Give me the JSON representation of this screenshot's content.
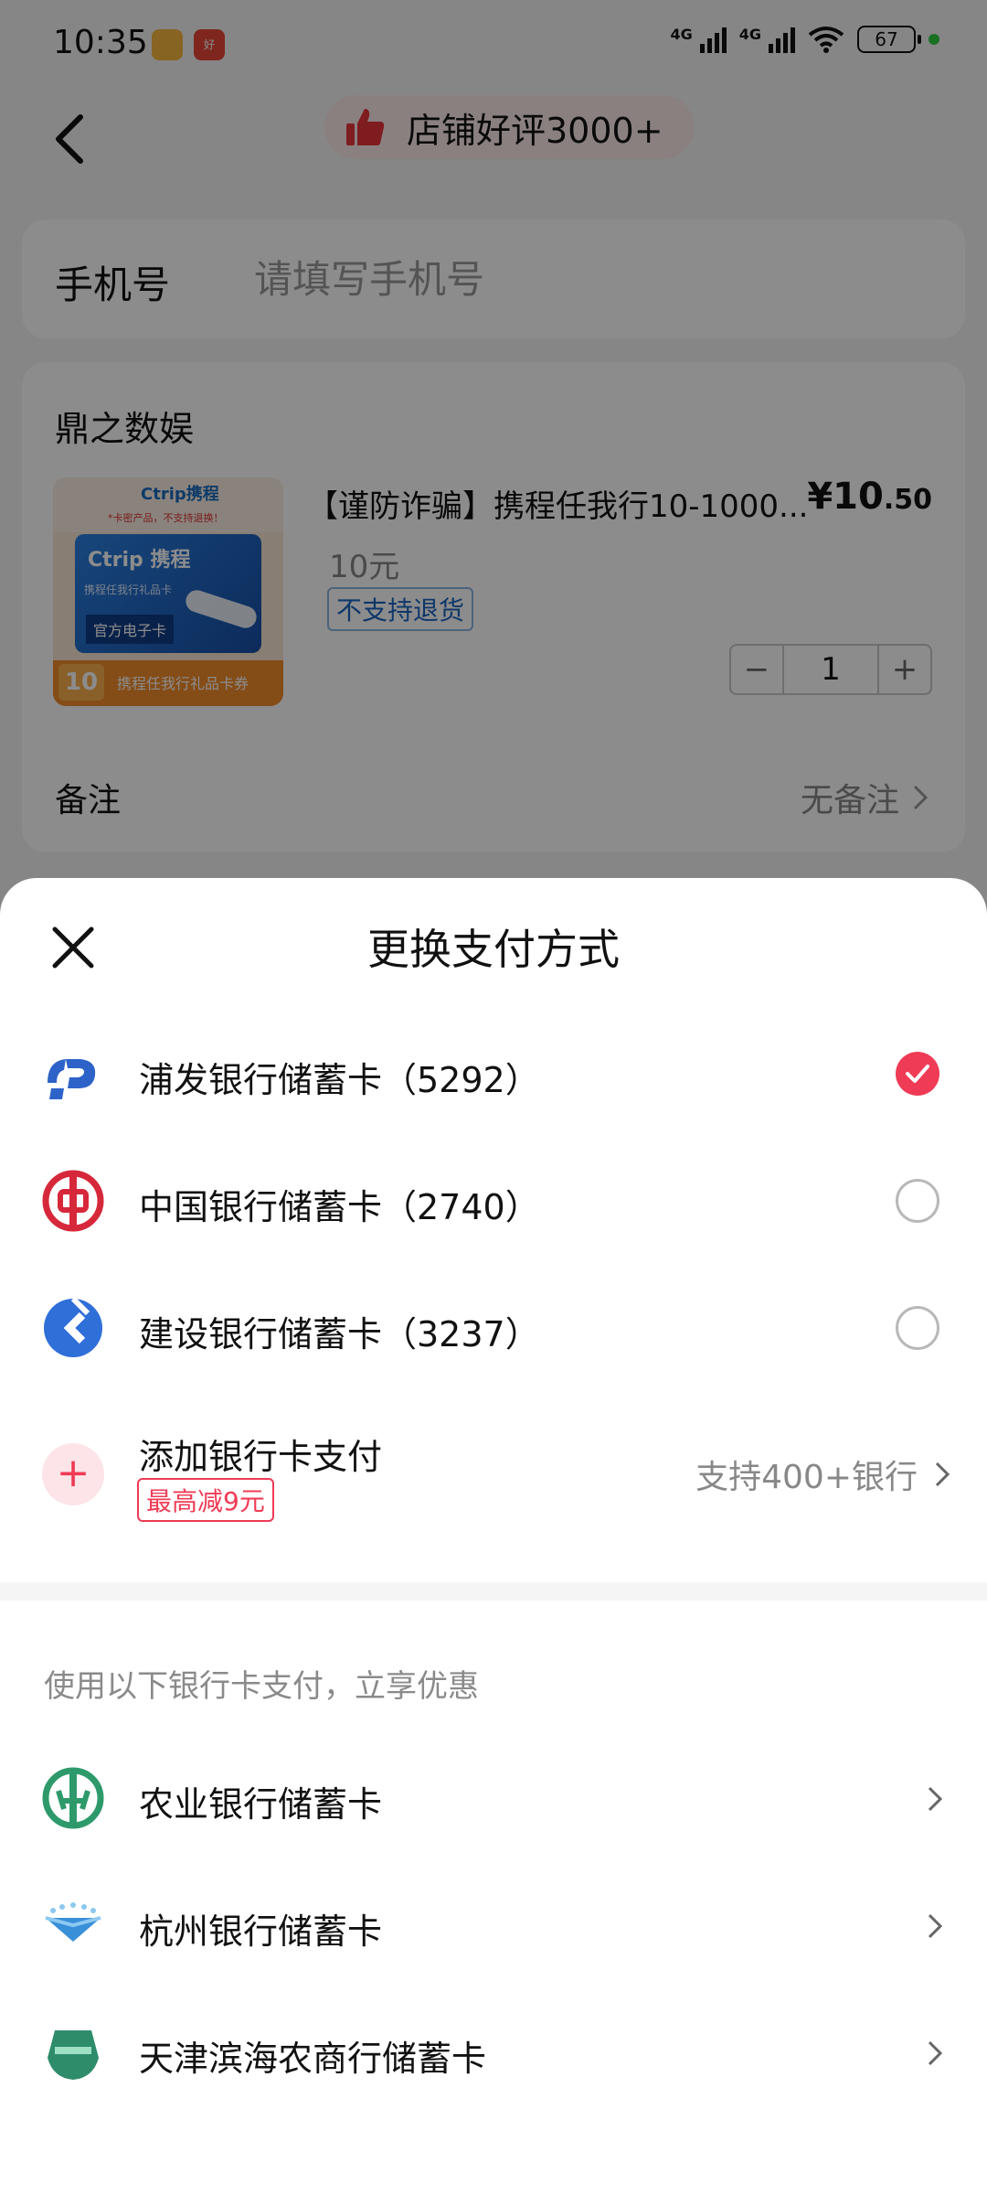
{
  "status_bar": {
    "time": "10:35",
    "network_1": "4G",
    "network_2": "4G",
    "battery": "67",
    "app2_label": "好"
  },
  "nav": {
    "rating_text": "店铺好评3000+"
  },
  "phone": {
    "label": "手机号",
    "placeholder": "请填写手机号"
  },
  "order": {
    "shop_name": "鼎之数娱",
    "product_title": "【谨防诈骗】携程任我行10-1000...",
    "price_main": "¥10",
    "price_decimal": ".50",
    "spec": "10元",
    "no_return": "不支持退货",
    "quantity": "1",
    "remark_label": "备注",
    "remark_value": "无备注",
    "image": {
      "logo": "Ctrip携程",
      "warning": "*卡密产品，不支持退换！",
      "card_logo": "Ctrip 携程",
      "card_sub": "携程任我行礼品卡",
      "card_tag": "官方电子卡",
      "badge": "10",
      "bottom_text": "携程任我行礼品卡券"
    }
  },
  "sheet": {
    "title": "更换支付方式",
    "methods": [
      {
        "name": "浦发银行储蓄卡（5292）",
        "icon": "spdb-icon",
        "selected": true
      },
      {
        "name": "中国银行储蓄卡（2740）",
        "icon": "boc-icon",
        "selected": false
      },
      {
        "name": "建设银行储蓄卡（3237）",
        "icon": "ccb-icon",
        "selected": false
      }
    ],
    "add_card": {
      "label": "添加银行卡支付",
      "discount": "最高减9元",
      "support": "支持400+银行"
    },
    "promo_hint": "使用以下银行卡支付，立享优惠",
    "promo_banks": [
      {
        "name": "农业银行储蓄卡",
        "icon": "abc-icon"
      },
      {
        "name": "杭州银行储蓄卡",
        "icon": "hzbank-icon"
      },
      {
        "name": "天津滨海农商行储蓄卡",
        "icon": "tjbhrcb-icon"
      }
    ]
  },
  "colors": {
    "accent": "#ef3b55",
    "overlay": "rgba(0,0,0,0.45)"
  }
}
